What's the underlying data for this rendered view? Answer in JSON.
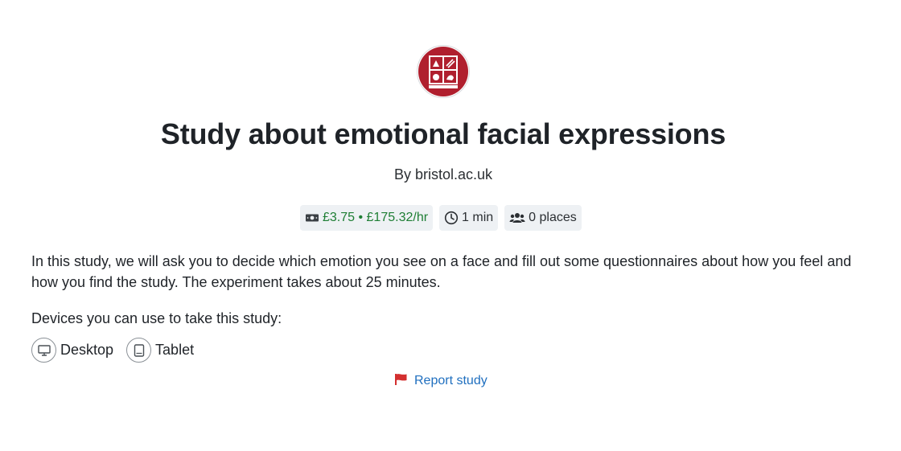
{
  "study": {
    "logo_icon": "university-crest-icon",
    "logo_color": "#b01f2e",
    "title": "Study about emotional facial expressions",
    "byline": "By bristol.ac.uk"
  },
  "chips": {
    "reward": {
      "icon": "money-icon",
      "text": "£3.75 • £175.32/hr",
      "color": "#1e7e34"
    },
    "duration": {
      "icon": "clock-icon",
      "text": "1 min"
    },
    "places": {
      "icon": "users-icon",
      "text": "0 places"
    }
  },
  "description": "In this study, we will ask you to decide which emotion you see on a face and fill out some questionnaires about how you feel and how you find the study. The experiment takes about 25 minutes.",
  "devices": {
    "label": "Devices you can use to take this study:",
    "items": [
      {
        "icon": "desktop-icon",
        "label": "Desktop"
      },
      {
        "icon": "tablet-icon",
        "label": "Tablet"
      }
    ]
  },
  "report": {
    "icon": "flag-icon",
    "label": "Report study",
    "icon_color": "#d32f2f",
    "link_color": "#1f6fbf"
  }
}
